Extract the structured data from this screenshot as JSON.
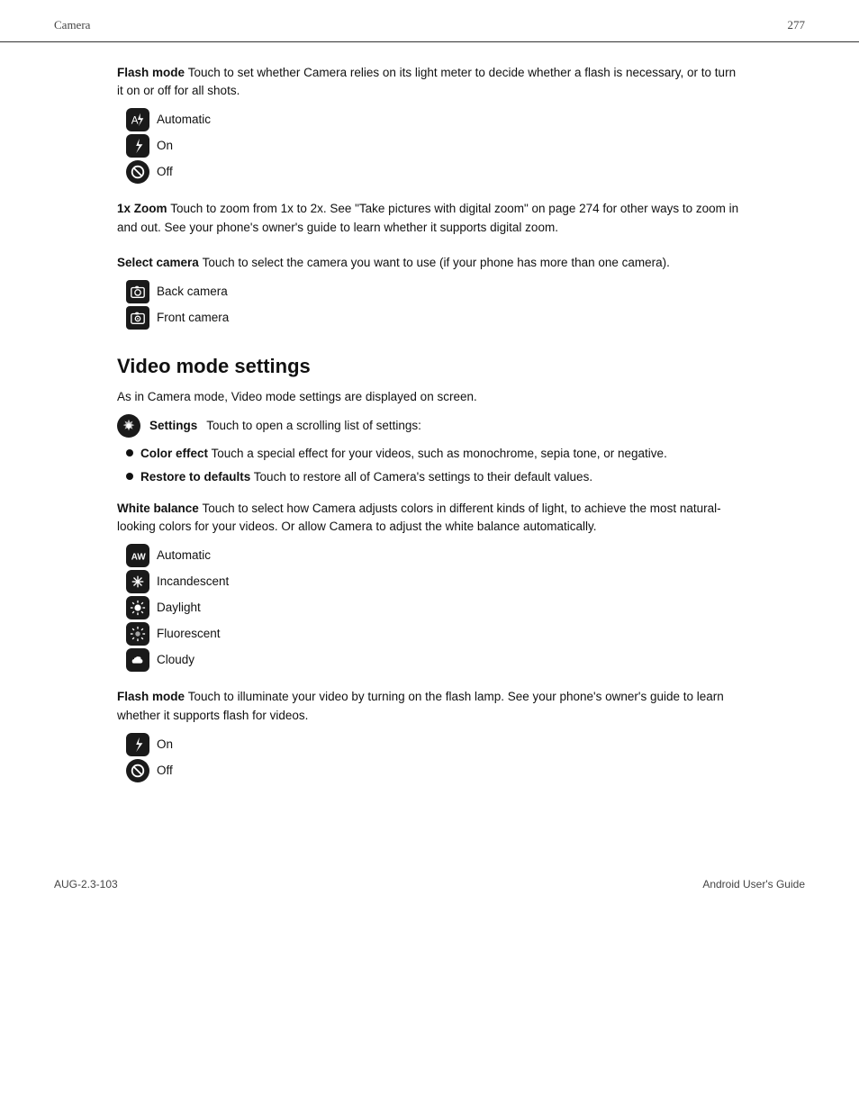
{
  "header": {
    "left": "Camera",
    "right": "277"
  },
  "flash_mode_section": {
    "term": "Flash mode",
    "description": "Touch to set whether Camera relies on its light meter to decide whether a flash is necessary, or to turn it on or off for all shots.",
    "options": [
      {
        "icon": "auto-flash",
        "label": "Automatic"
      },
      {
        "icon": "flash-on",
        "label": "On"
      },
      {
        "icon": "flash-off",
        "label": "Off"
      }
    ]
  },
  "zoom_section": {
    "term": "1x Zoom",
    "description": "Touch to zoom from 1x to 2x. See \"Take pictures with digital zoom\" on page 274 for other ways to zoom in and out. See your phone's owner's guide to learn whether it supports digital zoom."
  },
  "select_camera_section": {
    "term": "Select camera",
    "description": "Touch to select the camera you want to use (if your phone has more than one camera).",
    "options": [
      {
        "icon": "back-camera",
        "label": "Back camera"
      },
      {
        "icon": "front-camera",
        "label": "Front camera"
      }
    ]
  },
  "video_mode_heading": "Video mode settings",
  "video_mode_description": "As in Camera mode, Video mode settings are displayed on screen.",
  "settings_section": {
    "icon": "settings",
    "term": "Settings",
    "description": "Touch to open a scrolling list of settings:",
    "bullets": [
      {
        "term": "Color effect",
        "text": "Touch a special effect for your videos, such as monochrome, sepia tone, or negative."
      },
      {
        "term": "Restore to defaults",
        "text": "Touch to restore all of Camera's settings to their default values."
      }
    ]
  },
  "white_balance_section": {
    "term": "White balance",
    "description": "Touch to select how Camera adjusts colors in different kinds of light, to achieve the most natural-looking colors for your videos. Or allow Camera to adjust the white balance automatically.",
    "options": [
      {
        "icon": "wb-auto",
        "label": "Automatic"
      },
      {
        "icon": "wb-incandescent",
        "label": "Incandescent"
      },
      {
        "icon": "wb-daylight",
        "label": "Daylight"
      },
      {
        "icon": "wb-fluorescent",
        "label": "Fluorescent"
      },
      {
        "icon": "wb-cloudy",
        "label": "Cloudy"
      }
    ]
  },
  "flash_mode_video_section": {
    "term": "Flash mode",
    "description": "Touch to illuminate your video by turning on the flash lamp. See your phone's owner's guide to learn whether it supports flash for videos.",
    "options": [
      {
        "icon": "flash-on",
        "label": "On"
      },
      {
        "icon": "flash-off",
        "label": "Off"
      }
    ]
  },
  "footer": {
    "left": "AUG-2.3-103",
    "right": "Android User's Guide"
  }
}
